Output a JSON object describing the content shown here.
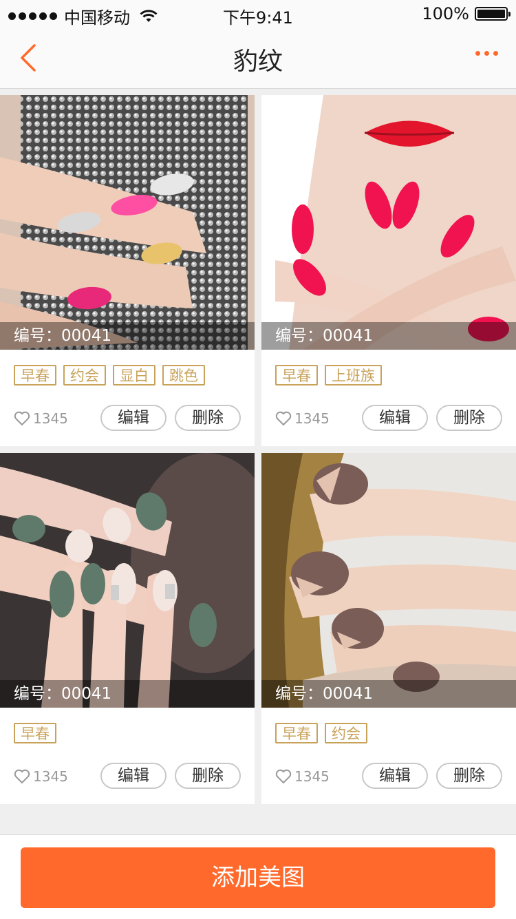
{
  "status_bar": {
    "carrier": "中国移动",
    "time": "下午9:41",
    "battery": "100%"
  },
  "nav": {
    "title": "豹纹",
    "back_icon": "chevron-left-icon",
    "more_icon": "more-dots-icon"
  },
  "cards": [
    {
      "caption": "编号：00041",
      "tags": [
        "早春",
        "约会",
        "显白",
        "跳色"
      ],
      "likes": "1345",
      "edit_label": "编辑",
      "delete_label": "删除"
    },
    {
      "caption": "编号：00041",
      "tags": [
        "早春",
        "上班族"
      ],
      "likes": "1345",
      "edit_label": "编辑",
      "delete_label": "删除"
    },
    {
      "caption": "编号：00041",
      "tags": [
        "早春"
      ],
      "likes": "1345",
      "edit_label": "编辑",
      "delete_label": "删除"
    },
    {
      "caption": "编号：00041",
      "tags": [
        "早春",
        "约会"
      ],
      "likes": "1345",
      "edit_label": "编辑",
      "delete_label": "删除"
    }
  ],
  "footer": {
    "add_label": "添加美图"
  },
  "colors": {
    "accent": "#ff6a2c",
    "tag": "#c9a25a"
  }
}
